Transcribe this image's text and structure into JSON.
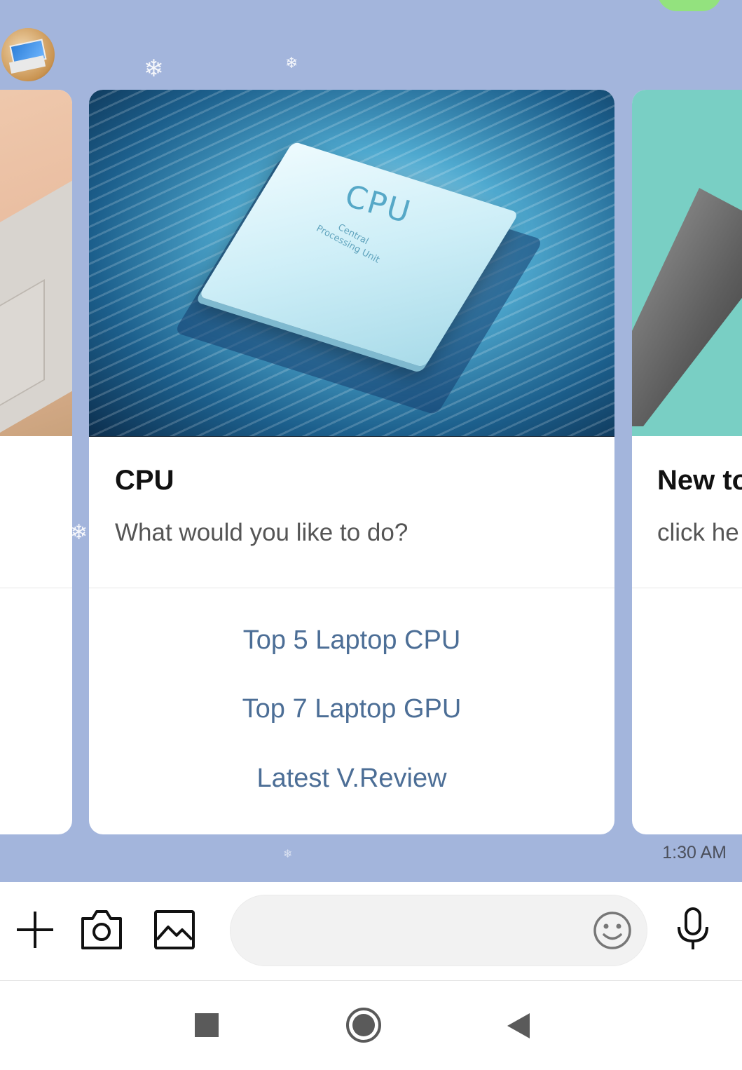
{
  "chat": {
    "time": "1:30 AM"
  },
  "cards": {
    "main": {
      "title": "CPU",
      "subtitle": "What would you like to do?",
      "image_text": "CPU",
      "image_subtext": "Central Processing Unit",
      "actions": [
        {
          "label": "Top 5 Laptop CPU"
        },
        {
          "label": "Top 7 Laptop GPU"
        },
        {
          "label": "Latest V.Review"
        }
      ]
    },
    "right": {
      "title": "New to",
      "subtitle": "click he"
    }
  },
  "input_bar": {
    "message_value": "",
    "message_placeholder": "",
    "icons": [
      "plus-icon",
      "camera-icon",
      "image-icon",
      "emoji-icon",
      "microphone-icon"
    ]
  },
  "nav_bar": {
    "icons": [
      "recent-apps-icon",
      "home-icon",
      "back-icon"
    ]
  },
  "colors": {
    "chat_background": "#a3b5dc",
    "action_link": "#4c6e96",
    "sent_bubble": "#93e27e"
  }
}
